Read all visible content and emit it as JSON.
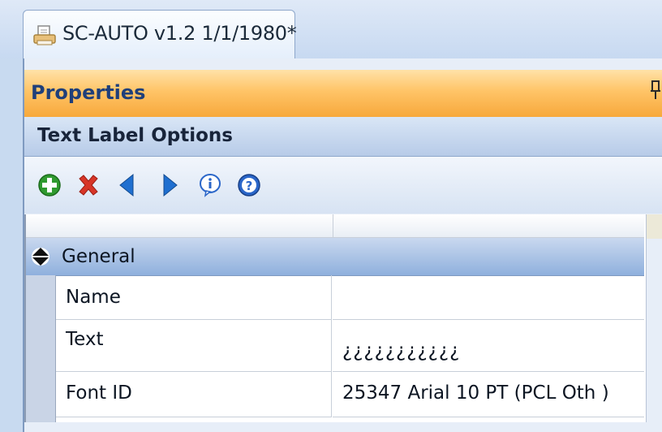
{
  "document_tab": {
    "icon": "document-printer-icon",
    "title": "SC-AUTO v1.2 1/1/1980*"
  },
  "properties_panel": {
    "title": "Properties",
    "pin_icon": "pin-icon"
  },
  "section": {
    "title": "Text Label Options"
  },
  "toolbar": {
    "buttons": [
      {
        "icon": "add-icon",
        "color": "#2f9a2f"
      },
      {
        "icon": "delete-icon",
        "color": "#d73527"
      },
      {
        "icon": "previous-icon",
        "color": "#1f6fd0"
      },
      {
        "icon": "next-icon",
        "color": "#1f6fd0"
      },
      {
        "icon": "info-icon",
        "color": "#2a66c9"
      },
      {
        "icon": "help-icon",
        "color": "#2a66c9"
      }
    ]
  },
  "property_grid": {
    "group": {
      "label": "General",
      "icon": "collapse-icon"
    },
    "rows": [
      {
        "name": "Name",
        "value": ""
      },
      {
        "name": "Text",
        "value": "¿¿¿¿¿¿¿¿¿¿¿"
      },
      {
        "name": "Font ID",
        "value": "25347 Arial 10 PT (PCL Oth )"
      }
    ]
  },
  "colors": {
    "accent_orange": "#f7a83b",
    "header_blue": "#1f3f7a",
    "group_blue": "#8fb0dd"
  }
}
